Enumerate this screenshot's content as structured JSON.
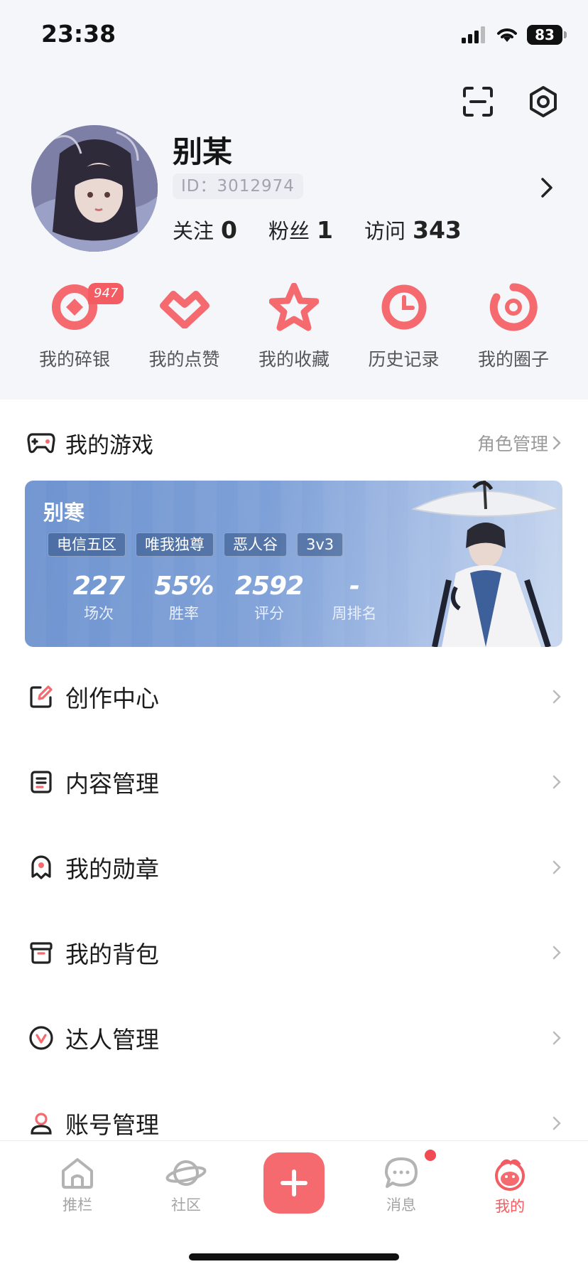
{
  "status_bar": {
    "time": "23:38",
    "battery": "83"
  },
  "profile": {
    "username": "别某",
    "id_label": "ID：3012974",
    "stats": [
      {
        "label": "关注",
        "value": "0"
      },
      {
        "label": "粉丝",
        "value": "1"
      },
      {
        "label": "访问",
        "value": "343"
      }
    ]
  },
  "quick_links": [
    {
      "label": "我的碎银",
      "icon": "silver-icon",
      "badge": "947"
    },
    {
      "label": "我的点赞",
      "icon": "like-icon"
    },
    {
      "label": "我的收藏",
      "icon": "star-icon"
    },
    {
      "label": "历史记录",
      "icon": "history-icon"
    },
    {
      "label": "我的圈子",
      "icon": "circle-icon"
    }
  ],
  "my_games": {
    "title": "我的游戏",
    "link": "角色管理",
    "card": {
      "character": "别寒",
      "tags": [
        "电信五区",
        "唯我独尊",
        "恶人谷",
        "3v3"
      ],
      "stats": [
        {
          "value": "227",
          "label": "场次"
        },
        {
          "value": "55%",
          "label": "胜率"
        },
        {
          "value": "2592",
          "label": "评分"
        },
        {
          "value": "-",
          "label": "周排名"
        }
      ]
    }
  },
  "menu": [
    {
      "label": "创作中心",
      "icon": "edit-icon"
    },
    {
      "label": "内容管理",
      "icon": "document-icon"
    },
    {
      "label": "我的勋章",
      "icon": "medal-icon"
    },
    {
      "label": "我的背包",
      "icon": "backpack-icon"
    },
    {
      "label": "达人管理",
      "icon": "expert-icon"
    },
    {
      "label": "账号管理",
      "icon": "account-icon"
    }
  ],
  "bottom_nav": {
    "items": [
      {
        "label": "推栏",
        "icon": "home-icon"
      },
      {
        "label": "社区",
        "icon": "planet-icon"
      },
      {
        "label": "消息",
        "icon": "message-icon"
      },
      {
        "label": "我的",
        "icon": "profile-icon"
      }
    ],
    "active": "我的"
  },
  "colors": {
    "accent": "#f25c62",
    "card_blue": "#7fa1d8",
    "background": "#f5f6fa"
  }
}
